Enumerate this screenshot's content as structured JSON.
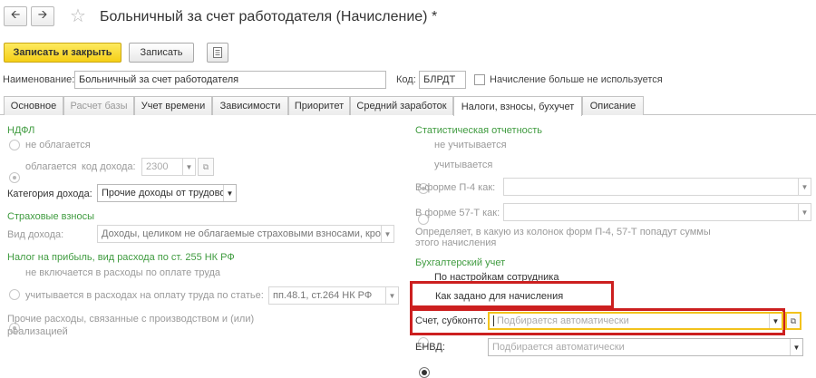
{
  "header": {
    "back_icon": "arrow-left-icon",
    "forward_icon": "arrow-right-icon",
    "favorite_icon": "star-icon",
    "title": "Больничный за счет работодателя (Начисление) *"
  },
  "toolbar": {
    "save_close_label": "Записать и закрыть",
    "save_label": "Записать",
    "report_icon": "document-list-icon"
  },
  "form": {
    "name_label": "Наименование:",
    "name_value": "Больничный за счет работодателя",
    "code_label": "Код:",
    "code_value": "БЛРДТ",
    "not_used_label": "Начисление больше не используется",
    "not_used_checked": false
  },
  "tabs": [
    {
      "label": "Основное",
      "state": "normal"
    },
    {
      "label": "Расчет базы",
      "state": "disabled"
    },
    {
      "label": "Учет времени",
      "state": "normal"
    },
    {
      "label": "Зависимости",
      "state": "normal"
    },
    {
      "label": "Приоритет",
      "state": "normal"
    },
    {
      "label": "Средний заработок",
      "state": "normal"
    },
    {
      "label": "Налоги, взносы, бухучет",
      "state": "active"
    },
    {
      "label": "Описание",
      "state": "normal"
    }
  ],
  "ndfl": {
    "heading": "НДФЛ",
    "option_not_taxed": "не облагается",
    "option_taxed": "облагается",
    "income_code_label": "код дохода:",
    "income_code_value": "2300",
    "category_label": "Категория дохода:",
    "category_value": "Прочие доходы от трудовой"
  },
  "insurance": {
    "heading": "Страховые взносы",
    "income_type_label": "Вид дохода:",
    "income_type_value": "Доходы, целиком не облагаемые страховыми взносами, кро"
  },
  "profit_tax": {
    "heading": "Налог на прибыль, вид расхода по ст. 255 НК РФ",
    "option_excluded": "не включается в расходы по оплате труда",
    "option_included": "учитывается в расходах на оплату труда по статье:",
    "article_value": "пп.48.1, ст.264 НК РФ",
    "other_expenses_text": "Прочие расходы, связанные с производством и (или) реализацией"
  },
  "statistics": {
    "heading": "Статистическая отчетность",
    "option_not_counted": "не учитывается",
    "option_counted": "учитывается",
    "p4_label": "В форме П-4 как:",
    "p4_value": "",
    "f57_label": "В форме 57-Т как:",
    "f57_value": "",
    "note": "Определяет, в какую из колонок форм П-4, 57-Т попадут суммы этого начисления"
  },
  "accounting": {
    "heading": "Бухгалтерский учет",
    "option_by_employee": "По настройкам сотрудника",
    "option_as_set": "Как задано для начисления",
    "account_label": "Счет, субконто:",
    "account_placeholder": "Подбирается автоматически",
    "envd_label": "ЕНВД:",
    "envd_placeholder": "Подбирается автоматически"
  },
  "colors": {
    "primary_button": "#f5cf17",
    "section_heading": "#3f9b3f",
    "highlight_red": "#cc1f1f",
    "highlight_yellow": "#f2c21c"
  }
}
